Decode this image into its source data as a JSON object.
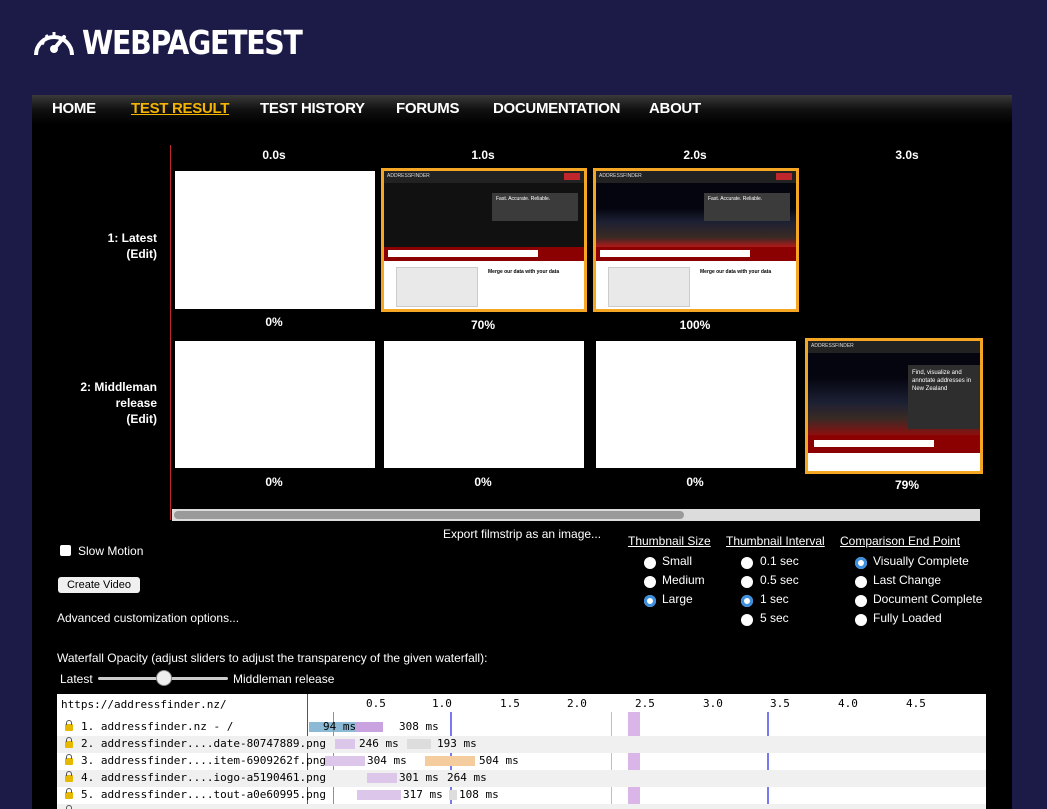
{
  "logo": {
    "text": "WEBPAGETEST"
  },
  "nav": {
    "items": [
      "HOME",
      "TEST RESULT",
      "TEST HISTORY",
      "FORUMS",
      "DOCUMENTATION",
      "ABOUT"
    ],
    "active": "TEST RESULT"
  },
  "filmstrip": {
    "times": [
      "0.0s",
      "1.0s",
      "2.0s",
      "3.0s"
    ],
    "rows": [
      {
        "label_line1": "1: Latest",
        "label_line2": "(Edit)",
        "percents": [
          "0%",
          "70%",
          "100%"
        ]
      },
      {
        "label_line1": "2: Middleman",
        "label_line2": "release",
        "label_line3": "(Edit)",
        "percents": [
          "0%",
          "0%",
          "0%",
          "79%"
        ]
      }
    ],
    "thumb_text": {
      "brand": "ADDRESSFINDER",
      "menu": [
        "Home",
        "Plans",
        "Examples",
        "Case Studies",
        "Docs",
        "Contact",
        "Login",
        "Sign up"
      ],
      "hero_title": "Fast. Accurate. Reliable.",
      "hero_sub": "Refreshed with the latest data, your New Zealand addresses are perfect. Every time.",
      "search_placeholder": "Type an address",
      "search_button": "Check it out",
      "section_title": "Merge our data with your data",
      "row2_hero": "Find, visualize and annotate addresses in New Zealand"
    }
  },
  "controls": {
    "slow_motion": "Slow Motion",
    "create_video": "Create Video",
    "advanced": "Advanced customization options...",
    "export": "Export filmstrip as an image...",
    "thumb_size": {
      "title": "Thumbnail Size",
      "options": [
        "Small",
        "Medium",
        "Large"
      ],
      "selected": "Large"
    },
    "thumb_interval": {
      "title": "Thumbnail Interval",
      "options": [
        "0.1 sec",
        "0.5 sec",
        "1 sec",
        "5 sec"
      ],
      "selected": "1 sec"
    },
    "end_point": {
      "title": "Comparison End Point",
      "options": [
        "Visually Complete",
        "Last Change",
        "Document Complete",
        "Fully Loaded"
      ],
      "selected": "Visually Complete"
    },
    "opacity_label": "Waterfall Opacity (adjust sliders to adjust the transparency of the given waterfall):",
    "slider_left": "Latest",
    "slider_right": "Middleman release"
  },
  "waterfall": {
    "url": "https://addressfinder.nz/",
    "ticks": [
      "0.5",
      "1.0",
      "1.5",
      "2.0",
      "2.5",
      "3.0",
      "3.5",
      "4.0",
      "4.5"
    ],
    "rows": [
      {
        "label": "1. addressfinder.nz - /",
        "t1": "94 ms",
        "t2": "308 ms"
      },
      {
        "label": "2. addressfinder....date-80747889.png",
        "t1": "246 ms",
        "t2": "193 ms"
      },
      {
        "label": "3. addressfinder....item-6909262f.png",
        "t1": "304 ms",
        "t2": "504 ms"
      },
      {
        "label": "4. addressfinder....iogo-a5190461.png",
        "t1": "301 ms",
        "t2": "264 ms"
      },
      {
        "label": "5. addressfinder....tout-a0e60995.png",
        "t1": "317 ms",
        "t2": "108 ms"
      }
    ]
  }
}
